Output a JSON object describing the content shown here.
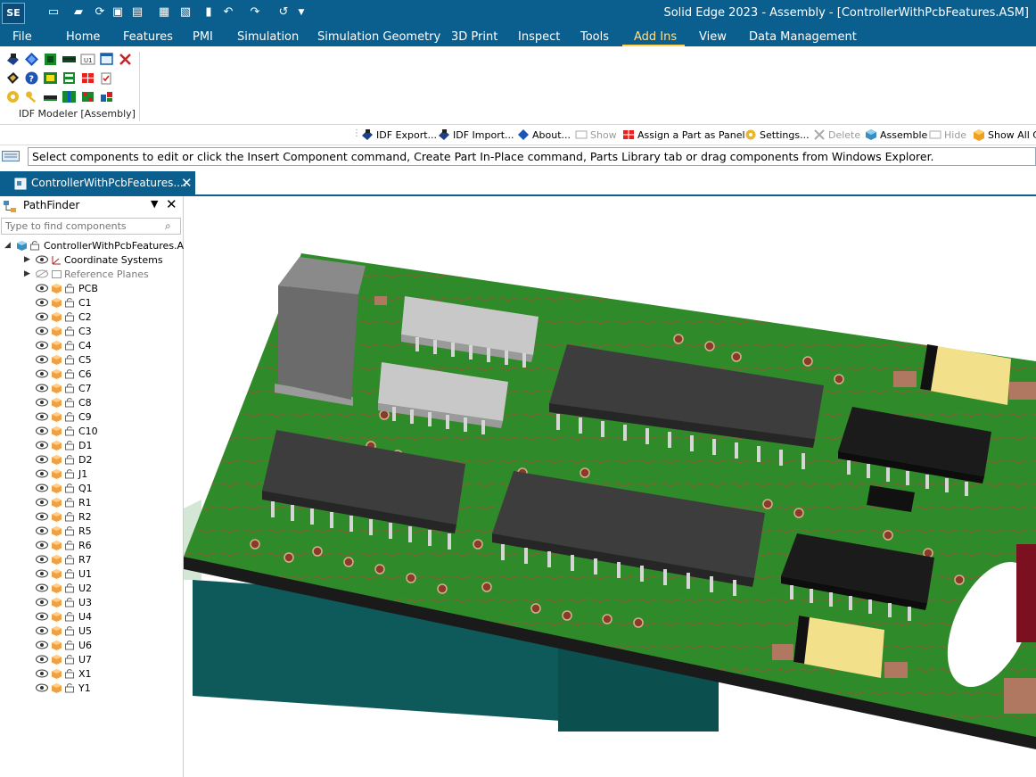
{
  "app": {
    "logo": "SE",
    "window_title": "Solid Edge 2023 - Assembly - [ControllerWithPcbFeatures.ASM]"
  },
  "tabs": [
    {
      "label": "File"
    },
    {
      "label": "Home"
    },
    {
      "label": "Features"
    },
    {
      "label": "PMI"
    },
    {
      "label": "Simulation"
    },
    {
      "label": "Simulation Geometry"
    },
    {
      "label": "3D Print"
    },
    {
      "label": "Inspect"
    },
    {
      "label": "Tools"
    },
    {
      "label": "Add Ins"
    },
    {
      "label": "View"
    },
    {
      "label": "Data Management"
    }
  ],
  "active_tab": "Add Ins",
  "ribbon": {
    "group_label": "IDF Modeler [Assembly]"
  },
  "commands": {
    "idf_export": "IDF Export...",
    "idf_import": "IDF Import...",
    "about": "About...",
    "show": "Show",
    "assign_panel": "Assign a Part as Panel",
    "settings": "Settings...",
    "delete": "Delete",
    "assemble": "Assemble",
    "hide": "Hide",
    "show_all": "Show All C"
  },
  "prompt": "Select components to edit or click the Insert Component command, Create Part In-Place command, Parts Library tab or drag components from Windows Explorer.",
  "document_tab": "ControllerWithPcbFeatures....",
  "pathfinder": {
    "title": "PathFinder",
    "search_placeholder": "Type to find components",
    "root": "ControllerWithPcbFeatures.A",
    "coordinate_systems": "Coordinate Systems",
    "reference_planes": "Reference Planes",
    "parts": [
      "PCB",
      "C1",
      "C2",
      "C3",
      "C4",
      "C5",
      "C6",
      "C7",
      "C8",
      "C9",
      "C10",
      "D1",
      "D2",
      "J1",
      "Q1",
      "R1",
      "R2",
      "R5",
      "R6",
      "R7",
      "U1",
      "U2",
      "U3",
      "U4",
      "U5",
      "U6",
      "U7",
      "X1",
      "Y1"
    ]
  },
  "colors": {
    "accent": "#0a5f8f",
    "pcb_green": "#2f8a2a",
    "ic_body": "#3a3a3a",
    "capacitor": "#f2e08a"
  }
}
